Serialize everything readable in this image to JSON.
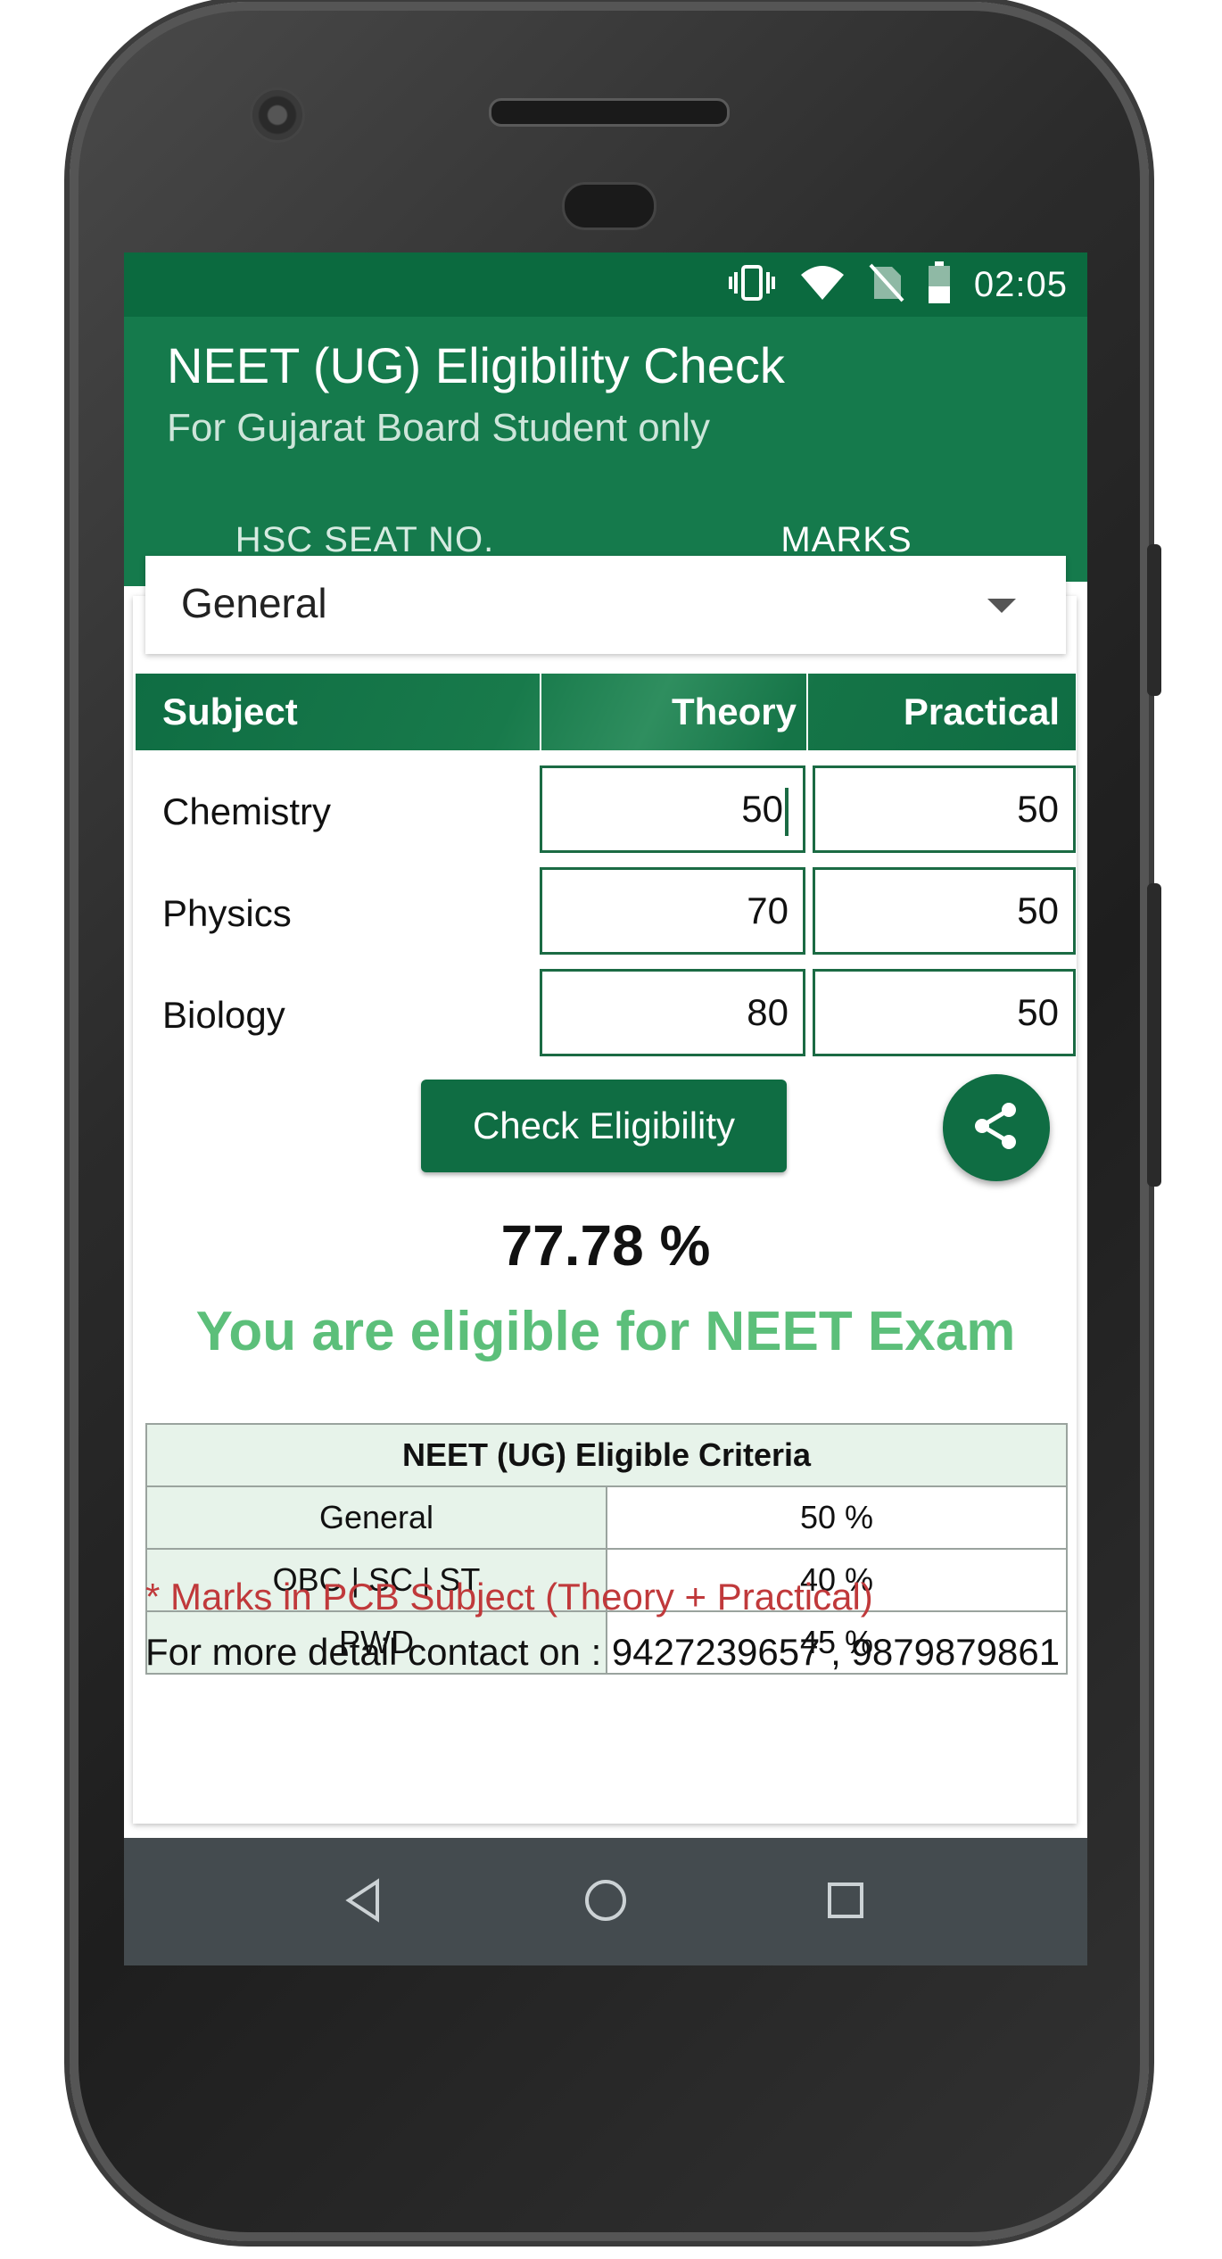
{
  "status_bar": {
    "time": "02:05",
    "icons": [
      "vibrate-icon",
      "wifi-icon",
      "no-sim-icon",
      "battery-icon"
    ]
  },
  "app_bar": {
    "title": "NEET (UG) Eligibility Check",
    "subtitle": "For Gujarat Board Student only",
    "tabs": [
      {
        "label": "HSC SEAT NO.",
        "selected": false
      },
      {
        "label": "MARKS",
        "selected": true
      }
    ]
  },
  "category_dropdown": {
    "value": "General"
  },
  "marks_table": {
    "headers": {
      "subject": "Subject",
      "theory": "Theory",
      "practical": "Practical"
    },
    "rows": [
      {
        "subject": "Chemistry",
        "theory": "50",
        "practical": "50"
      },
      {
        "subject": "Physics",
        "theory": "70",
        "practical": "50"
      },
      {
        "subject": "Biology",
        "theory": "80",
        "practical": "50"
      }
    ]
  },
  "check_button_label": "Check Eligibility",
  "share_icon": "share-icon",
  "result": {
    "percentage": "77.78 %",
    "message": "You are eligible for NEET Exam"
  },
  "criteria_table": {
    "title": "NEET (UG) Eligible Criteria",
    "rows": [
      {
        "category": "General",
        "percent": "50 %"
      },
      {
        "category": "OBC | SC | ST",
        "percent": "40 %"
      },
      {
        "category": "PWD",
        "percent": "45 %"
      }
    ]
  },
  "notes": {
    "pcb_note": "* Marks in PCB Subject (Theory + Practical)",
    "contact": "For more detail contact on : 9427239657 , 9879879861"
  },
  "nav_bar": {
    "buttons": [
      "back-icon",
      "home-icon",
      "recents-icon"
    ]
  },
  "colors": {
    "primary": "#157a4c",
    "primary_dark": "#0b6a3f",
    "success_text": "#5cbf7a",
    "note_red": "#c0393b"
  }
}
